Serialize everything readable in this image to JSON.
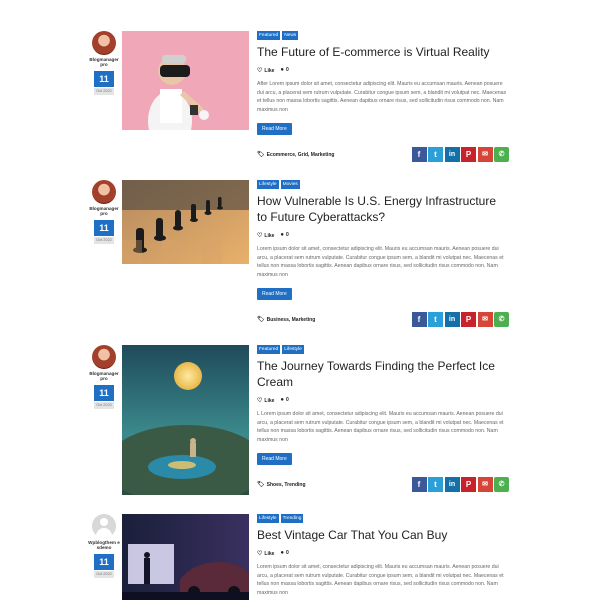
{
  "colors": {
    "accent": "#1f6fc5",
    "facebook": "#3b5998",
    "twitter": "#2a9fd8",
    "linkedin": "#1670a8",
    "pinterest": "#c8232c",
    "email": "#d64537",
    "whatsapp": "#4caf50"
  },
  "read_more_label": "Read More",
  "like_label": "Like",
  "posts": [
    {
      "author": "Blogmanager pro",
      "avatar": "photo-avatar",
      "day": "11",
      "month": "Oct 2022",
      "categories": [
        "Featured",
        "News"
      ],
      "title": "The Future of E-commerce is Virtual Reality",
      "likes": "0",
      "excerpt": "After Lorem ipsum dolor sit amet, consectetur adipiscing elit. Mauris eu accumsan mauris. Aenean posuere dui arcu, a placerat sem rutrum vulputate. Curabitur congue ipsum sem, a blandit mi volutpat nec. Maecenas et tellus non massa lobortis sagittis. Aenean dapibus ornare risus, sed sollicitudin risus commodo non. Nam maximus non",
      "tags": "Ecommerce, Grid, Marketing"
    },
    {
      "author": "Blogmanager pro",
      "avatar": "photo-avatar",
      "day": "11",
      "month": "Oct 2022",
      "categories": [
        "Lifestyle",
        "Movies"
      ],
      "title": "How Vulnerable Is U.S. Energy Infrastructure to Future Cyberattacks?",
      "likes": "0",
      "excerpt": "Lorem ipsum dolor sit amet, consectetur adipiscing elit. Mauris eu accumsan mauris. Aenean posuere dui arcu, a placerat sem rutrum vulputate. Curabitur congue ipsum sem, a blandit mi volutpat nec. Maecenas et tellus non massa lobortis sagittis. Aenean dapibus ornare risus, sed sollicitudin risus commodo non. Nam maximus non",
      "tags": "Business, Marketing"
    },
    {
      "author": "Blogmanager pro",
      "avatar": "photo-avatar",
      "day": "11",
      "month": "Oct 2022",
      "categories": [
        "Featured",
        "Lifestyle"
      ],
      "title": "The Journey Towards Finding the Perfect Ice Cream",
      "likes": "0",
      "excerpt": "L Lorem ipsum dolor sit amet, consectetur adipiscing elit. Mauris eu accumsan mauris. Aenean posuere dui arcu, a placerat sem rutrum vulputate. Curabitur congue ipsum sem, a blandit mi volutpat nec. Maecenas et tellus non massa lobortis sagittis. Aenean dapibus ornare risus, sed sollicitudin risus commodo non. Nam maximus non",
      "tags": "Shoes, Trending"
    },
    {
      "author": "Wpblogthem esdemo",
      "avatar": "default-avatar",
      "day": "11",
      "month": "Oct 2022",
      "categories": [
        "Lifestyle",
        "Trending"
      ],
      "title": "Best Vintage Car That You Can Buy",
      "likes": "0",
      "excerpt": "Lorem ipsum dolor sit amet, consectetur adipiscing elit. Mauris eu accumsan mauris. Aenean posuere dui arcu, a placerat sem rutrum vulputate. Curabitur congue ipsum sem, a blandit mi volutpat nec. Maecenas et tellus non massa lobortis sagittis. Aenean dapibus ornare risus, sed sollicitudin risus commodo non. Nam maximus non"
    }
  ]
}
